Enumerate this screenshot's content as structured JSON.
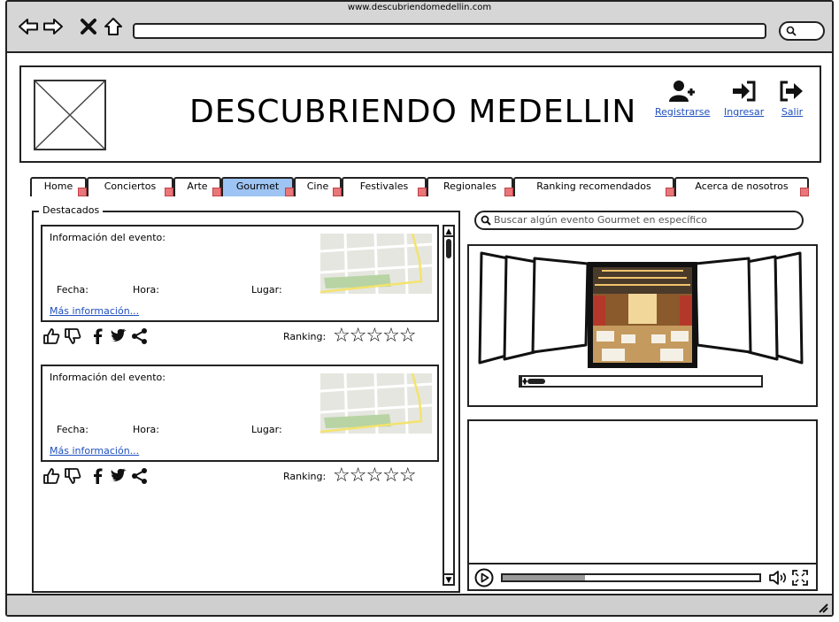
{
  "browser": {
    "url": "www.descubriendomedellin.com"
  },
  "header": {
    "title": "DESCUBRIENDO MEDELLIN",
    "actions": [
      {
        "label": "Registrarse",
        "icon": "add-user-icon"
      },
      {
        "label": "Ingresar",
        "icon": "sign-in-icon"
      },
      {
        "label": "Salir",
        "icon": "sign-out-icon"
      }
    ]
  },
  "tabs": [
    {
      "label": "Home",
      "active": false
    },
    {
      "label": "Conciertos",
      "active": false
    },
    {
      "label": "Arte",
      "active": false
    },
    {
      "label": "Gourmet",
      "active": true
    },
    {
      "label": "Cine",
      "active": false
    },
    {
      "label": "Festivales",
      "active": false
    },
    {
      "label": "Regionales",
      "active": false
    },
    {
      "label": "Ranking recomendados",
      "active": false
    },
    {
      "label": "Acerca de nosotros",
      "active": false
    }
  ],
  "destacados": {
    "legend": "Destacados",
    "events": [
      {
        "info_label": "Información del evento:",
        "fecha_label": "Fecha:",
        "hora_label": "Hora:",
        "lugar_label": "Lugar:",
        "more_link": "Más información...",
        "ranking_label": "Ranking:",
        "stars": "☆☆☆☆☆"
      },
      {
        "info_label": "Información del evento:",
        "fecha_label": "Fecha:",
        "hora_label": "Hora:",
        "lugar_label": "Lugar:",
        "more_link": "Más información...",
        "ranking_label": "Ranking:",
        "stars": "☆☆☆☆☆"
      }
    ]
  },
  "search": {
    "placeholder": "Buscar algún evento Gourmet en específico"
  },
  "video": {
    "progress_fraction": 0.32
  },
  "colors": {
    "active_tab": "#9ec4f3",
    "link": "#1f4fbf",
    "chrome": "#d6d6d6"
  }
}
